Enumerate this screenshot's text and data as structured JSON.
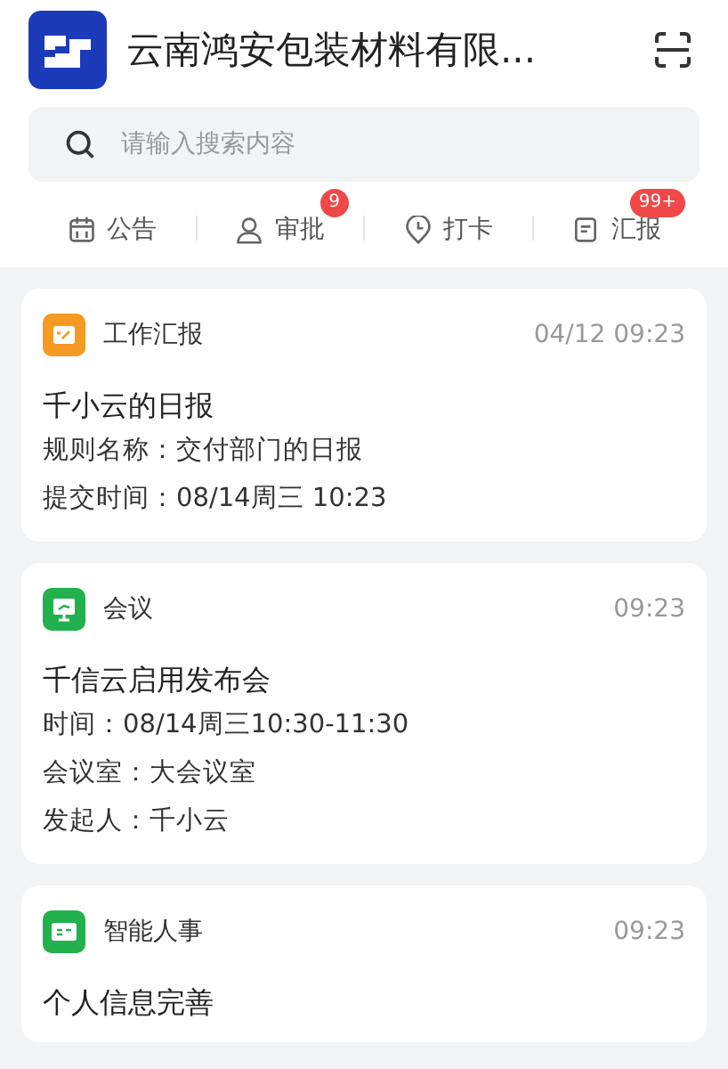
{
  "header": {
    "company": "云南鸿安包装材料有限..."
  },
  "search": {
    "placeholder": "请输入搜索内容"
  },
  "shortcuts": [
    {
      "kind": "notice",
      "label": "公告"
    },
    {
      "kind": "approval",
      "label": "审批",
      "badge": "9"
    },
    {
      "kind": "checkin",
      "label": "打卡"
    },
    {
      "kind": "report",
      "label": "汇报",
      "badge": "99+"
    }
  ],
  "cards": [
    {
      "kind": "report",
      "color": "#f59a23",
      "source": "工作汇报",
      "time": "04/12 09:23",
      "title": "千小云的日报",
      "lines": [
        "规则名称：交付部门的日报",
        "提交时间：08/14周三 10:23"
      ]
    },
    {
      "kind": "meeting",
      "color": "#22b14c",
      "source": "会议",
      "time": "09:23",
      "title": "千信云启用发布会",
      "lines": [
        "时间：08/14周三10:30-11:30",
        "会议室：大会议室",
        "发起人：千小云"
      ]
    },
    {
      "kind": "hr",
      "color": "#22b14c",
      "source": "智能人事",
      "time": "09:23",
      "title": "个人信息完善"
    }
  ]
}
